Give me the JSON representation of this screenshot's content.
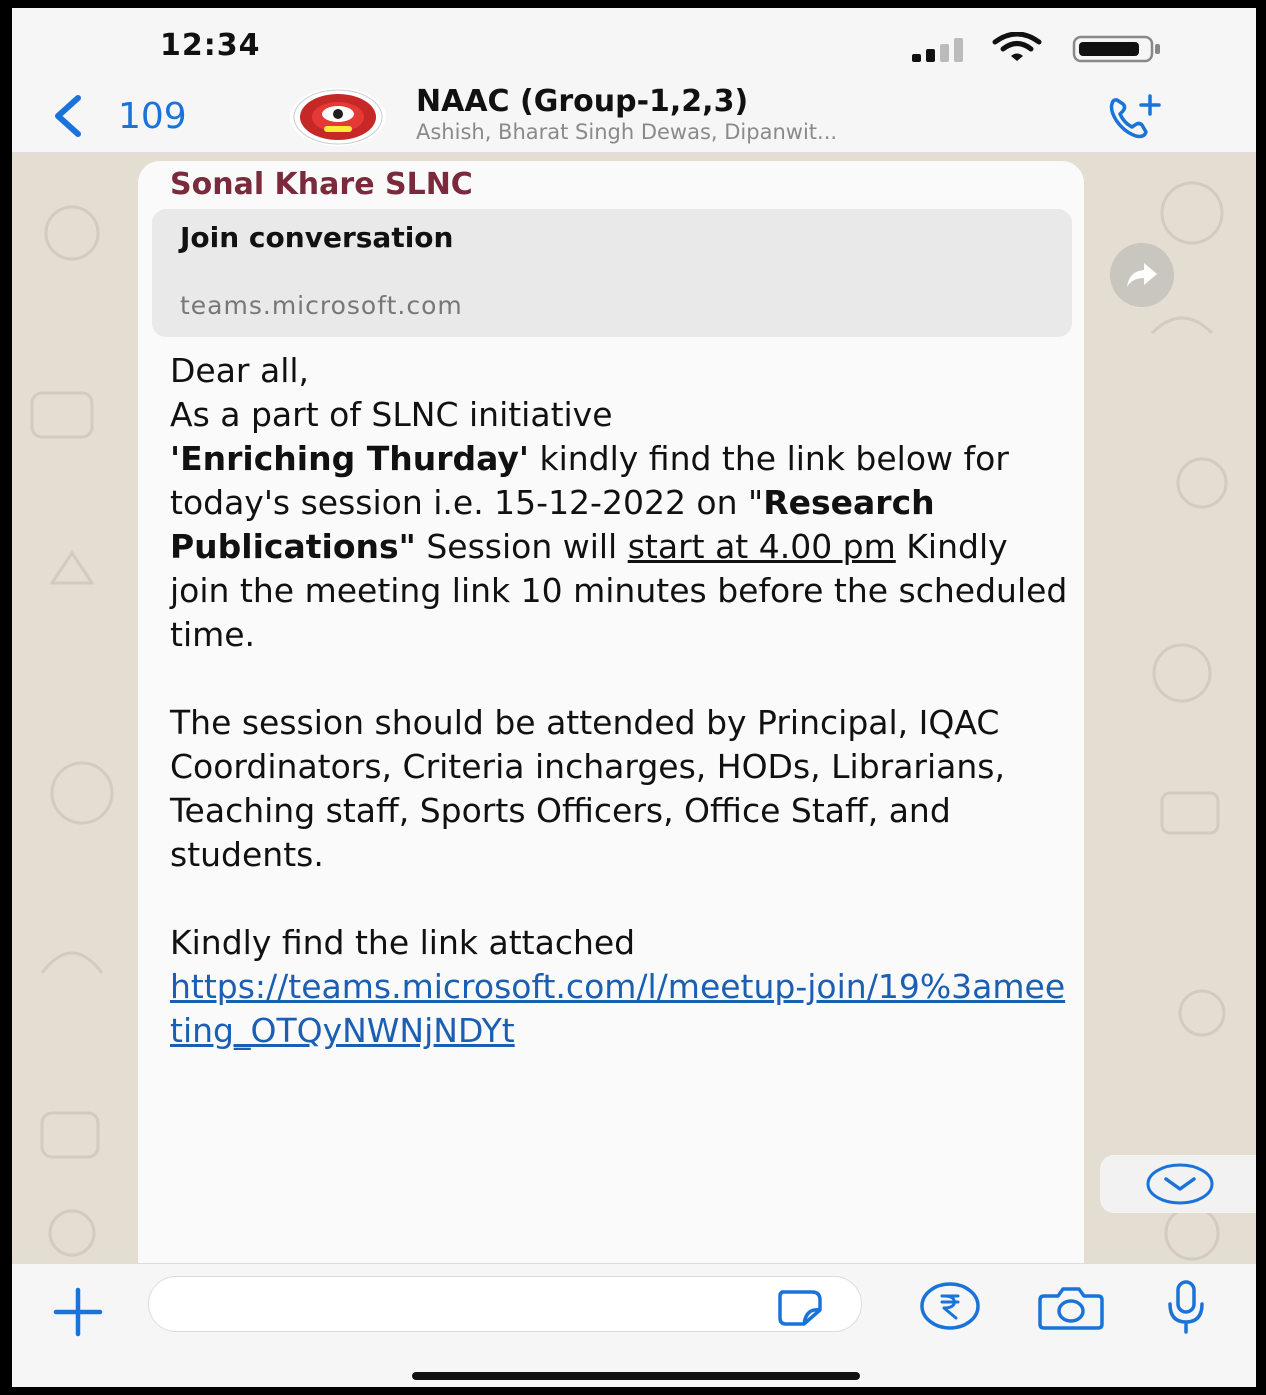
{
  "status_bar": {
    "time": "12:34"
  },
  "header": {
    "back_count": "109",
    "group_name": "NAAC (Group-1,2,3)",
    "members": "Ashish, Bharat Singh Dewas, Dipanwit..."
  },
  "message": {
    "sender": "Sonal Khare SLNC",
    "link_preview": {
      "title": "Join conversation",
      "domain": "teams.microsoft.com"
    },
    "para1": {
      "l1": "Dear all,",
      "l2": "As a part of SLNC initiative",
      "l3_bold": "'Enriching Thurday'",
      "l3_rest": "  kindly find the link below  for today's session i.e. 15-12-2022 on  \"",
      "l4_bold": "Research Publications\"",
      "l4_rest": " Session will ",
      "l4_underlined": "start at 4.00 pm",
      "l4_end": "  Kindly join the meeting link  10 minutes before the scheduled time."
    },
    "para2": "The session should be  attended by Principal, IQAC Coordinators, Criteria incharges, HODs, Librarians, Teaching staff, Sports Officers, Office Staff, and students.",
    "para3": "Kindly find the link attached",
    "url": "https://teams.microsoft.com/l/meetup-join/19%3ameeting_OTQyNWNjNDYt"
  },
  "colors": {
    "accent": "#1a73d9",
    "sender_name": "#7a2a3b",
    "link": "#1a5fb4",
    "chat_background": "#e4ddd2",
    "bubble": "#fafafa"
  },
  "icons": {
    "back": "chevron-left-icon",
    "call": "phone-plus-icon",
    "forward": "forward-arrow-icon",
    "scroll_down": "chevron-down-circle-icon",
    "attach": "plus-icon",
    "sticker": "sticker-icon",
    "payment": "rupee-icon",
    "camera": "camera-icon",
    "mic": "microphone-icon"
  }
}
